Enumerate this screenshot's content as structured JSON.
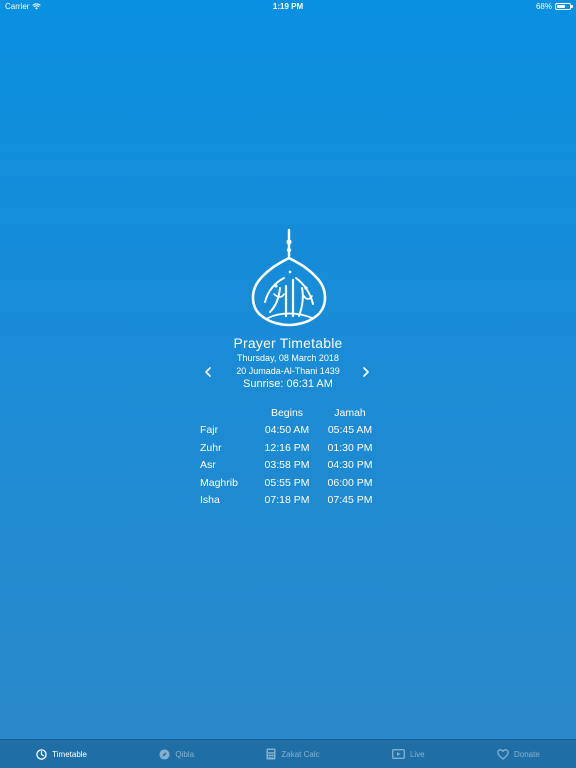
{
  "status_bar": {
    "carrier": "Carrier",
    "time": "1:19 PM",
    "battery": "68%",
    "battery_level": 0.68
  },
  "main": {
    "title": "Prayer Timetable",
    "gregorian_date": "Thursday, 08 March 2018",
    "hijri_date": "20 Jumada-Al-Thani 1439",
    "sunrise": "Sunrise: 06:31 AM",
    "prev_icon": "chevron-left-icon",
    "next_icon": "chevron-right-icon"
  },
  "timetable": {
    "headers": [
      "",
      "Begins",
      "Jamah"
    ],
    "rows": [
      {
        "name": "Fajr",
        "begins": "04:50 AM",
        "jamah": "05:45 AM"
      },
      {
        "name": "Zuhr",
        "begins": "12:16 PM",
        "jamah": "01:30 PM"
      },
      {
        "name": "Asr",
        "begins": "03:58 PM",
        "jamah": "04:30 PM"
      },
      {
        "name": "Maghrib",
        "begins": "05:55 PM",
        "jamah": "06:00 PM"
      },
      {
        "name": "Isha",
        "begins": "07:18 PM",
        "jamah": "07:45 PM"
      }
    ]
  },
  "tab_bar": {
    "items": [
      {
        "label": "Timetable",
        "icon": "clock-icon",
        "active": true
      },
      {
        "label": "Qibla",
        "icon": "compass-icon",
        "active": false
      },
      {
        "label": "Zakat Calc",
        "icon": "calculator-icon",
        "active": false
      },
      {
        "label": "Live",
        "icon": "video-icon",
        "active": false
      },
      {
        "label": "Donate",
        "icon": "heart-icon",
        "active": false
      }
    ]
  },
  "colors": {
    "background_top": "#0a90e0",
    "background_bottom": "#2a88c8",
    "tab_bar": "#1f6fa6",
    "text": "#ffffff"
  }
}
